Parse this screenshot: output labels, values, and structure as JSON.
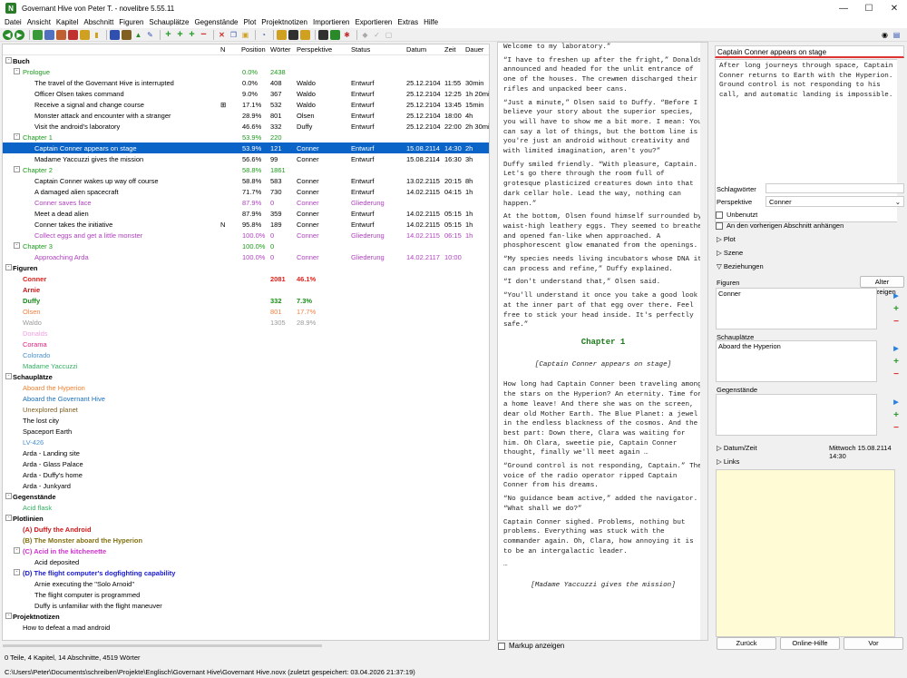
{
  "window": {
    "title": "Governant Hive von Peter T. - novelibre 5.55.11",
    "icon": "N"
  },
  "menu": [
    "Datei",
    "Ansicht",
    "Kapitel",
    "Abschnitt",
    "Figuren",
    "Schauplätze",
    "Gegenstände",
    "Plot",
    "Projektnotizen",
    "Importieren",
    "Exportieren",
    "Extras",
    "Hilfe"
  ],
  "columns": {
    "no": "N",
    "position": "Position",
    "words": "Wörter",
    "viewpoint": "Perspektive",
    "status": "Status",
    "date": "Datum",
    "time": "Zeit",
    "duration": "Dauer"
  },
  "tree": [
    {
      "label": "Buch",
      "level": 0,
      "color": "#000",
      "bold": true,
      "exp": "-"
    },
    {
      "label": "Prologue",
      "level": 1,
      "color": "#1a9a1a",
      "exp": "-",
      "pos": "0.0%",
      "words": "2438",
      "poscolor": "#1a9a1a"
    },
    {
      "label": "The travel of the Governant Hive is interrupted",
      "level": 2,
      "pos": "0.0%",
      "words": "408",
      "pv": "Waldo",
      "status": "Entwurf",
      "date": "25.12.2104",
      "time": "11:55",
      "dur": "30min"
    },
    {
      "label": "Officer Olsen takes command",
      "level": 2,
      "pos": "9.0%",
      "words": "367",
      "pv": "Waldo",
      "status": "Entwurf",
      "date": "25.12.2104",
      "time": "12:25",
      "dur": "1h 20min"
    },
    {
      "label": "Receive a signal and change course",
      "level": 2,
      "no": "⊞",
      "pos": "17.1%",
      "words": "532",
      "pv": "Waldo",
      "status": "Entwurf",
      "date": "25.12.2104",
      "time": "13:45",
      "dur": "15min"
    },
    {
      "label": "Monster attack and encounter with a stranger",
      "level": 2,
      "pos": "28.9%",
      "words": "801",
      "pv": "Olsen",
      "status": "Entwurf",
      "date": "25.12.2104",
      "time": "18:00",
      "dur": "4h"
    },
    {
      "label": "Visit the android's laboratory",
      "level": 2,
      "pos": "46.6%",
      "words": "332",
      "pv": "Duffy",
      "status": "Entwurf",
      "date": "25.12.2104",
      "time": "22:00",
      "dur": "2h 30min"
    },
    {
      "label": "Chapter 1",
      "level": 1,
      "color": "#1a9a1a",
      "exp": "-",
      "pos": "53.9%",
      "words": "220",
      "poscolor": "#1a9a1a"
    },
    {
      "label": "Captain Conner appears on stage",
      "level": 2,
      "sel": true,
      "pos": "53.9%",
      "words": "121",
      "pv": "Conner",
      "status": "Entwurf",
      "date": "15.08.2114",
      "time": "14:30",
      "dur": "2h"
    },
    {
      "label": "Madame Yaccuzzi gives the mission",
      "level": 2,
      "pos": "56.6%",
      "words": "99",
      "pv": "Conner",
      "status": "Entwurf",
      "date": "15.08.2114",
      "time": "16:30",
      "dur": "3h"
    },
    {
      "label": "Chapter 2",
      "level": 1,
      "color": "#1a9a1a",
      "exp": "-",
      "pos": "58.8%",
      "words": "1861",
      "poscolor": "#1a9a1a"
    },
    {
      "label": "Captain Conner wakes up way off course",
      "level": 2,
      "pos": "58.8%",
      "words": "583",
      "pv": "Conner",
      "status": "Entwurf",
      "date": "13.02.2115",
      "time": "20:15",
      "dur": "8h"
    },
    {
      "label": "A damaged alien spacecraft",
      "level": 2,
      "pos": "71.7%",
      "words": "730",
      "pv": "Conner",
      "status": "Entwurf",
      "date": "14.02.2115",
      "time": "04:15",
      "dur": "1h"
    },
    {
      "label": "Conner saves face",
      "level": 2,
      "color": "#b040c0",
      "pos": "87.9%",
      "words": "0",
      "pv": "Conner",
      "status": "Gliederung"
    },
    {
      "label": "Meet a dead alien",
      "level": 2,
      "pos": "87.9%",
      "words": "359",
      "pv": "Conner",
      "status": "Entwurf",
      "date": "14.02.2115",
      "time": "05:15",
      "dur": "1h"
    },
    {
      "label": "Conner takes the initiative",
      "level": 2,
      "no": "N",
      "pos": "95.8%",
      "words": "189",
      "pv": "Conner",
      "status": "Entwurf",
      "date": "14.02.2115",
      "time": "05:15",
      "dur": "1h"
    },
    {
      "label": "Collect eggs and get a little monster",
      "level": 2,
      "color": "#b040c0",
      "pos": "100.0%",
      "words": "0",
      "pv": "Conner",
      "status": "Gliederung",
      "date": "14.02.2115",
      "time": "06:15",
      "dur": "1h"
    },
    {
      "label": "Chapter 3",
      "level": 1,
      "color": "#1a9a1a",
      "exp": "-",
      "pos": "100.0%",
      "words": "0",
      "poscolor": "#1a9a1a"
    },
    {
      "label": "Approaching Arda",
      "level": 2,
      "color": "#b040c0",
      "pos": "100.0%",
      "words": "0",
      "pv": "Conner",
      "status": "Gliederung",
      "date": "14.02.2117",
      "time": "10:00"
    },
    {
      "label": "Figuren",
      "level": 0,
      "bold": true,
      "exp": "-"
    },
    {
      "label": "Conner",
      "level": 1,
      "color": "#e0201a",
      "bold": true,
      "words": "2081",
      "pvtext": "46.1%",
      "wcolor": "#e0201a"
    },
    {
      "label": "Arnie",
      "level": 1,
      "color": "#c01818",
      "bold": true
    },
    {
      "label": "Duffy",
      "level": 1,
      "color": "#1a8a1a",
      "bold": true,
      "words": "332",
      "pvtext": "7.3%",
      "wcolor": "#1a8a1a"
    },
    {
      "label": "Olsen",
      "level": 1,
      "color": "#f08040",
      "words": "801",
      "pvtext": "17.7%",
      "wcolor": "#f08040"
    },
    {
      "label": "Waldo",
      "level": 1,
      "color": "#999",
      "words": "1305",
      "pvtext": "28.9%",
      "wcolor": "#999"
    },
    {
      "label": "Donalds",
      "level": 1,
      "color": "#f0a0e0"
    },
    {
      "label": "Corama",
      "level": 1,
      "color": "#e02080"
    },
    {
      "label": "Colorado",
      "level": 1,
      "color": "#4a90d0"
    },
    {
      "label": "Madame Yaccuzzi",
      "level": 1,
      "color": "#30b060"
    },
    {
      "label": "Schauplätze",
      "level": 0,
      "bold": true,
      "exp": "-"
    },
    {
      "label": "Aboard the Hyperion",
      "level": 1,
      "color": "#f08030"
    },
    {
      "label": "Aboard the Governant Hive",
      "level": 1,
      "color": "#1a70c0"
    },
    {
      "label": "Unexplored planet",
      "level": 1,
      "color": "#806020"
    },
    {
      "label": "The lost city",
      "level": 1
    },
    {
      "label": "Spaceport Earth",
      "level": 1
    },
    {
      "label": "LV-426",
      "level": 1,
      "color": "#4a90d0"
    },
    {
      "label": "Arda - Landing site",
      "level": 1
    },
    {
      "label": "Arda - Glass Palace",
      "level": 1
    },
    {
      "label": "Arda - Duffy's home",
      "level": 1
    },
    {
      "label": "Arda - Junkyard",
      "level": 1
    },
    {
      "label": "Gegenstände",
      "level": 0,
      "bold": true,
      "exp": "-"
    },
    {
      "label": "Acid flask",
      "level": 1,
      "color": "#30b060"
    },
    {
      "label": "Plotlinien",
      "level": 0,
      "bold": true,
      "exp": "-"
    },
    {
      "label": "(A) Duffy the Android",
      "level": 1,
      "color": "#d01818",
      "bold": true
    },
    {
      "label": "(B) The Monster aboard the Hyperion",
      "level": 1,
      "color": "#807010",
      "bold": true
    },
    {
      "label": "(C) Acid in the kitchenette",
      "level": 1,
      "color": "#d030d0",
      "bold": true,
      "exp": "-"
    },
    {
      "label": "Acid deposited",
      "level": 2
    },
    {
      "label": "(D) The flight computer's dogfighting capability",
      "level": 1,
      "color": "#1818d0",
      "bold": true,
      "exp": "-"
    },
    {
      "label": "Arnie executing the \"Solo Arnoid\"",
      "level": 2
    },
    {
      "label": "The flight computer is programmed",
      "level": 2
    },
    {
      "label": "Duffy is unfamiliar with the flight maneuver",
      "level": 2
    },
    {
      "label": "Projektnotizen",
      "level": 0,
      "bold": true,
      "exp": "-"
    },
    {
      "label": "How to defeat a mad android",
      "level": 1
    }
  ],
  "editor": {
    "paras": [
      "Welcome to my laboratory.”",
      "“I have to freshen up after the fright,” Donalds announced and headed for the unlit entrance of one of the houses. The crewmen discharged their rifles and unpacked beer cans.",
      "“Just a minute,” Olsen said to Duffy. “Before I believe your story about the superior species, you will have to show me a bit more. I mean: You can say a lot of things, but the bottom line is you're just an android without creativity and with limited imagination, aren't you?”",
      "Duffy smiled friendly. “With pleasure, Captain. Let's go there through the room full of grotesque plasticized creatures down into that dark cellar hole. Lead the way, nothing can happen.”",
      "At the bottom, Olsen found himself surrounded by waist-high leathery eggs. They seemed to breathe and opened fan-like when approached. A phosphorescent glow emanated from the openings.",
      "“My species needs living incubators whose DNA it can process and refine,” Duffy explained.",
      "“I don't understand that,” Olsen said.",
      "“You'll understand it once you take a good look at the inner part of that egg over there. Feel free to stick your head inside. It's perfectly safe.”"
    ],
    "chapter": "Chapter 1",
    "scene": "[Captain Conner appears on stage]",
    "paras2": [
      "How long had Captain Conner been traveling among the stars on the Hyperion? An eternity. Time for a home leave! And there she was on the screen, dear old Mother Earth. The Blue Planet: a jewel in the endless blackness of the cosmos. And the best part: Down there, Clara was waiting for him. Oh Clara, sweetie pie, Captain Conner thought, finally we'll meet again …",
      "“Ground control is not responding, Captain.” The voice of the radio operator ripped Captain Conner from his dreams.",
      "“No guidance beam active,” added the navigator. “What shall we do?”",
      "Captain Conner sighed. Problems, nothing but problems. Everything was stuck with the commander again. Oh, Clara, how annoying it is to be an intergalactic leader.",
      "…"
    ],
    "scene2": "[Madame Yaccuzzi gives the mission]",
    "markup_label": "Markup anzeigen"
  },
  "props": {
    "title": "Captain Conner appears on stage",
    "desc": "After long journeys through space, Captain Conner returns to Earth with the Hyperion. Ground control is not responding to his call, and automatic landing is impossible.",
    "tags_label": "Schlagwörter",
    "viewpoint_label": "Perspektive",
    "viewpoint": "Conner",
    "unused_label": "Unbenutzt",
    "append_label": "An den vorherigen Abschnitt anhängen",
    "plot_label": "Plot",
    "scene_label": "Szene",
    "relations_label": "Beziehungen",
    "chars_label": "Figuren",
    "show_ages": "Alter anzeigen",
    "chars": "Conner",
    "locs_label": "Schauplätze",
    "locs": "Aboard the Hyperion",
    "items_label": "Gegenstände",
    "datetime_label": "Datum/Zeit",
    "datetime": "Mittwoch 15.08.2114 14:30",
    "links_label": "Links",
    "back": "Zurück",
    "help": "Online-Hilfe",
    "next": "Vor"
  },
  "status": {
    "counts": "0 Teile, 4 Kapitel, 14 Abschnitte, 4519 Wörter",
    "path": "C:\\Users\\Peter\\Documents\\schreiben\\Projekte\\Englisch\\Governant Hive\\Governant Hive.novx (zuletzt gespeichert: 03.04.2026 21:37:19)"
  }
}
